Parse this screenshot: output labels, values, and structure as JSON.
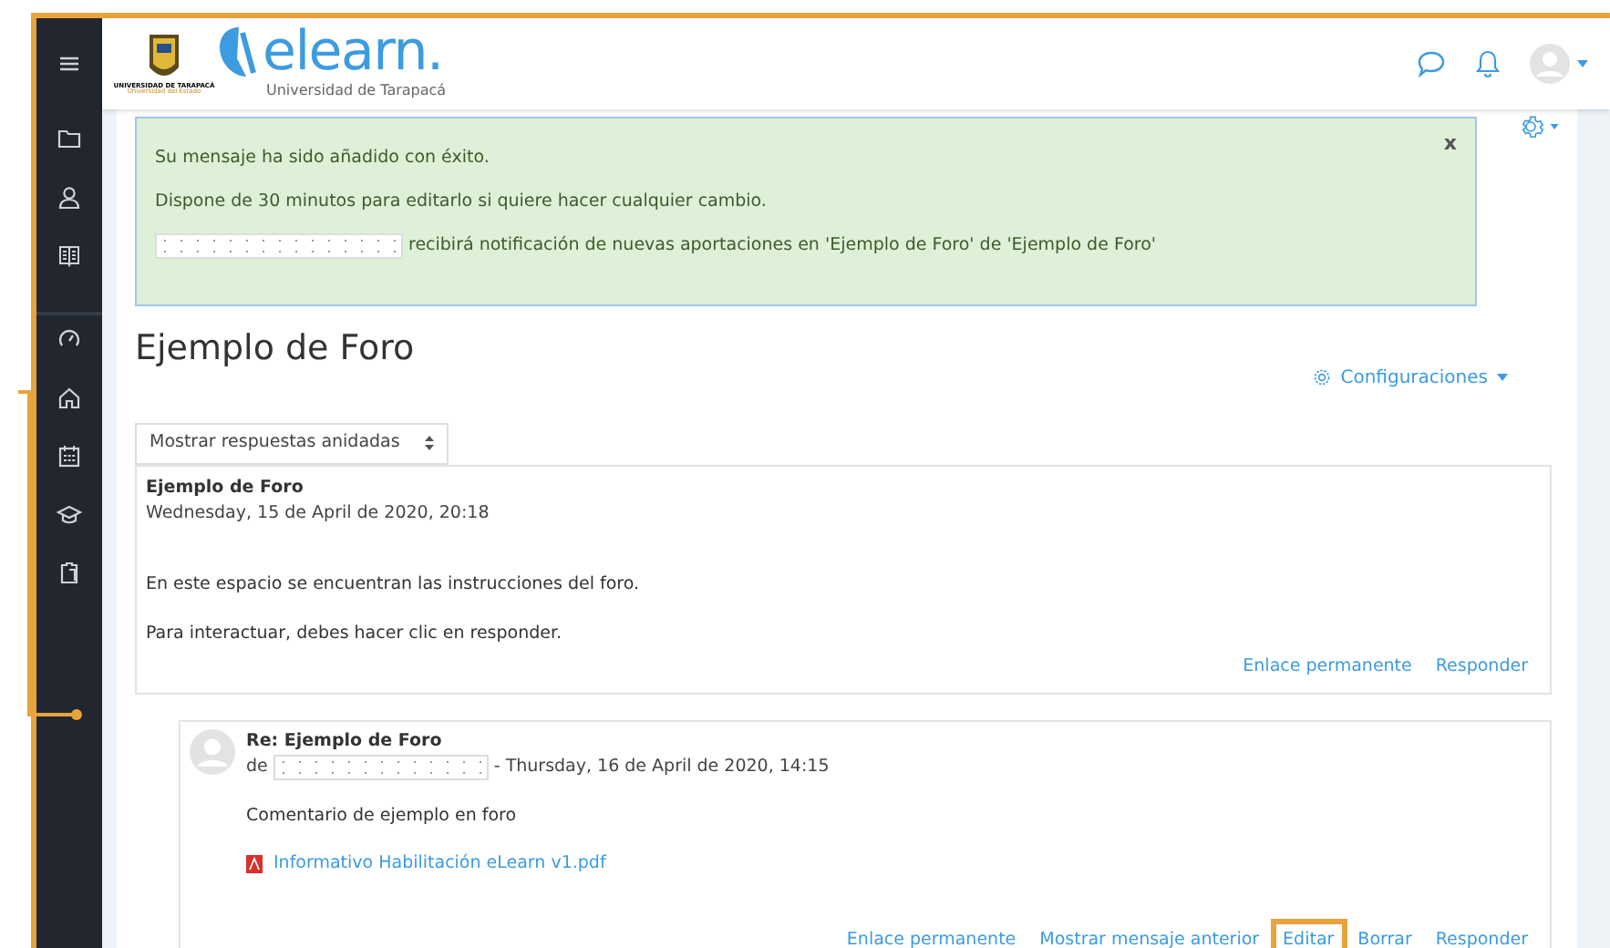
{
  "header": {
    "logo_text": "elearn.",
    "subtitle": "Universidad de Tarapacá",
    "crest_caption": "UNIVERSIDAD DE TARAPACÁ",
    "crest_tagline": "Universidad del Estado"
  },
  "alert": {
    "close": "x",
    "lines": [
      {
        "kind": "text",
        "text": "Su mensaje ha sido añadido con éxito."
      },
      {
        "kind": "text",
        "text": "Dispone de 30 minutos para editarlo si quiere hacer cualquier cambio."
      },
      {
        "kind": "redacted",
        "text": "recibirá notificación de nuevas aportaciones en 'Ejemplo de Foro' de 'Ejemplo de Foro'"
      }
    ]
  },
  "page_title": "Ejemplo de Foro",
  "settings_menu": "Configuraciones",
  "display_mode": "Mostrar respuestas anidadas",
  "posts": [
    {
      "subject": "Ejemplo de Foro",
      "date": "Wednesday, 15 de April de 2020, 20:18",
      "body": [
        "En este espacio se encuentran las instrucciones del foro.",
        "Para interactuar, debes hacer clic en responder."
      ],
      "actions": [
        {
          "label": "Enlace permanente",
          "highlighted": false
        },
        {
          "label": "Responder",
          "highlighted": false
        }
      ]
    },
    {
      "subject": "Re: Ejemplo de Foro",
      "byline": "de",
      "date": "- Thursday, 16 de April de 2020, 14:15",
      "body": [
        "Comentario de ejemplo en foro"
      ],
      "attachment": "Informativo Habilitación eLearn v1.pdf",
      "actions": [
        {
          "label": "Enlace permanente",
          "highlighted": false
        },
        {
          "label": "Mostrar mensaje anterior",
          "highlighted": false
        },
        {
          "label": "Editar",
          "highlighted": true
        },
        {
          "label": "Borrar",
          "highlighted": false
        },
        {
          "label": "Responder",
          "highlighted": false
        }
      ]
    }
  ]
}
